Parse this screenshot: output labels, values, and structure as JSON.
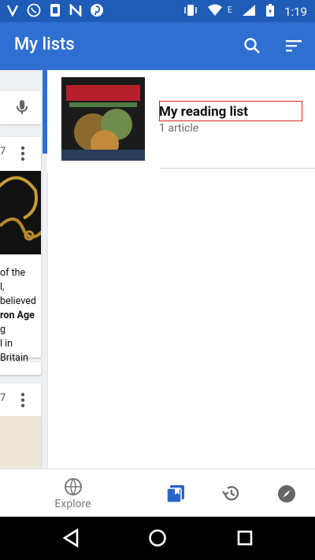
{
  "status_bar": {
    "time": "1:19",
    "notification_icons": [
      "v-icon",
      "whatsapp-icon",
      "phone-icon",
      "n-icon",
      "pinterest-icon"
    ],
    "system_icons": [
      "vibrate-icon",
      "wifi-icon",
      "signal-icon",
      "battery-icon"
    ],
    "network_label": "E"
  },
  "app_bar": {
    "title": "My lists",
    "actions": [
      "search-icon",
      "sort-icon"
    ]
  },
  "lists": [
    {
      "title": "My reading list",
      "subtitle": "1 article"
    }
  ],
  "left_panel": {
    "card1": {
      "number": "7",
      "snippet_parts": [
        "of the",
        "l, believed",
        "ron Age",
        " g",
        "l in Britain"
      ]
    },
    "card2": {
      "number": "7"
    }
  },
  "bottom_nav": {
    "items": [
      {
        "label": "Explore",
        "icon": "globe-icon"
      },
      {
        "label": "",
        "icon": "reading-lists-icon"
      },
      {
        "label": "",
        "icon": "history-icon"
      },
      {
        "label": "",
        "icon": "compass-icon"
      }
    ]
  },
  "colors": {
    "primary": "#2f6fd1",
    "status": "#1f5cb7",
    "accent_selected": "#2a64c8"
  }
}
